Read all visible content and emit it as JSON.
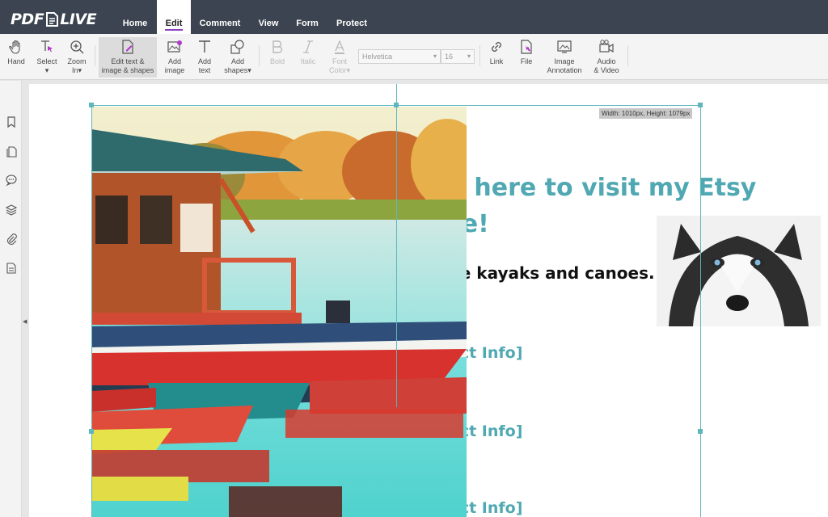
{
  "app": {
    "logo_left": "PDF",
    "logo_right": "LIVE"
  },
  "nav": {
    "tabs": [
      "Home",
      "Edit",
      "Comment",
      "View",
      "Form",
      "Protect"
    ],
    "active": "Edit"
  },
  "toolbar": {
    "hand": "Hand",
    "select": "Select",
    "zoom": [
      "Zoom",
      "In"
    ],
    "edit_text": [
      "Edit text &",
      "image & shapes"
    ],
    "add_image": [
      "Add",
      "image"
    ],
    "add_text": [
      "Add",
      "text"
    ],
    "add_shapes": [
      "Add",
      "shapes"
    ],
    "bold": "Bold",
    "italic": "Italic",
    "font_color": [
      "Font",
      "Color"
    ],
    "font_family": "Helvetica",
    "font_size": "16",
    "link": "Link",
    "file": "File",
    "image_annotation": [
      "Image",
      "Annotation"
    ],
    "audio_video": [
      "Audio",
      "& Video"
    ]
  },
  "sidebar": {
    "icons": [
      "bookmark-icon",
      "pages-icon",
      "comments-icon",
      "layers-icon",
      "attachment-icon",
      "form-fields-icon"
    ]
  },
  "document": {
    "etsy_line1": "k here to visit my Etsy",
    "etsy_line2": "re!",
    "kayaks": "ke kayaks and canoes.",
    "contact": [
      "act Info]",
      "act Info]",
      "act Info]"
    ],
    "selection_size": "Width: 1010px, Height: 1079px"
  },
  "colors": {
    "accent": "#4fa8b2",
    "topbar": "#3b4450",
    "active_underline": "#8a3fbf"
  }
}
